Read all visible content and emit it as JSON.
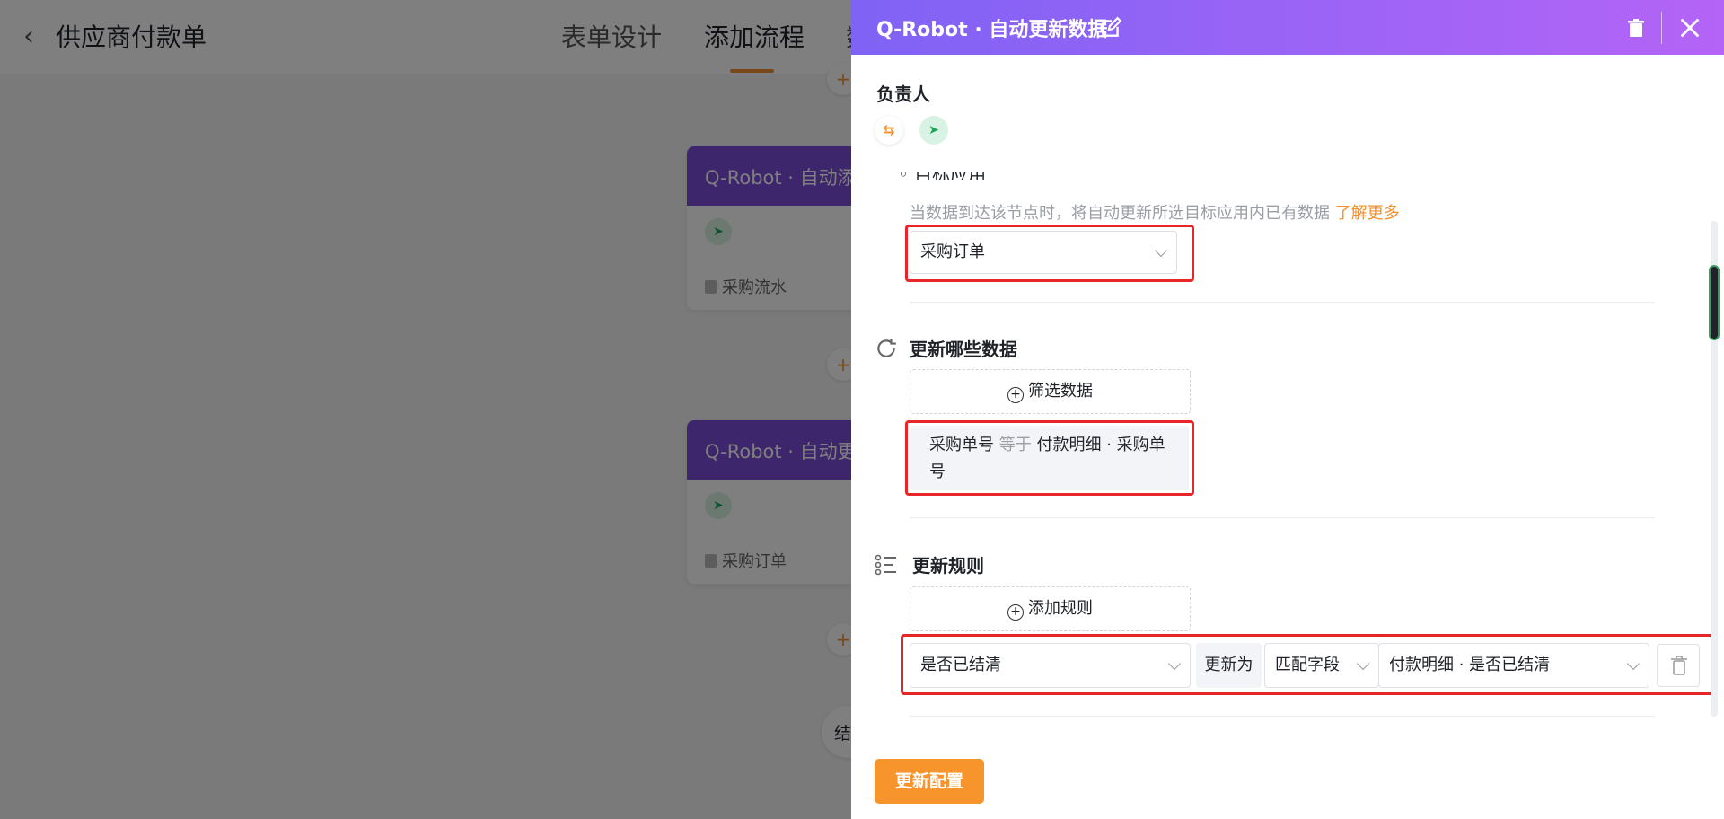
{
  "page": {
    "title": "供应商付款单",
    "tabs": [
      {
        "label": "表单设计",
        "active": false
      },
      {
        "label": "添加流程",
        "active": true
      }
    ],
    "tab_partial_glyph": "数"
  },
  "canvas": {
    "nodes": [
      {
        "title": "Q-Robot · 自动添",
        "app": "采购流水"
      },
      {
        "title": "Q-Robot · 自动更",
        "app": "采购订单"
      }
    ],
    "end_label": "结",
    "plus_glyph": "+"
  },
  "drawer": {
    "title": "Q-Robot · 自动更新数据",
    "owner_label": "负责人",
    "target_app": {
      "description": "当数据到达该节点时，将自动更新所选目标应用内已有数据",
      "learn_more": "了解更多",
      "selected": "采购订单"
    },
    "which_data": {
      "title": "更新哪些数据",
      "filter_button": "筛选数据",
      "filter": {
        "field": "采购单号",
        "operator": "等于",
        "value": "付款明细 · 采购单号"
      }
    },
    "rules": {
      "title": "更新规则",
      "add_button": "添加规则",
      "items": [
        {
          "field": "是否已结清",
          "action": "更新为",
          "mode": "匹配字段",
          "source": "付款明细 · 是否已结清"
        }
      ]
    },
    "save_button": "更新配置"
  },
  "colors": {
    "accent_orange": "#f7952c",
    "header_gradient_start": "#7f63f5",
    "header_gradient_end": "#b464f6",
    "node_header": "#7c4ddb",
    "highlight_red": "#e8262a"
  }
}
